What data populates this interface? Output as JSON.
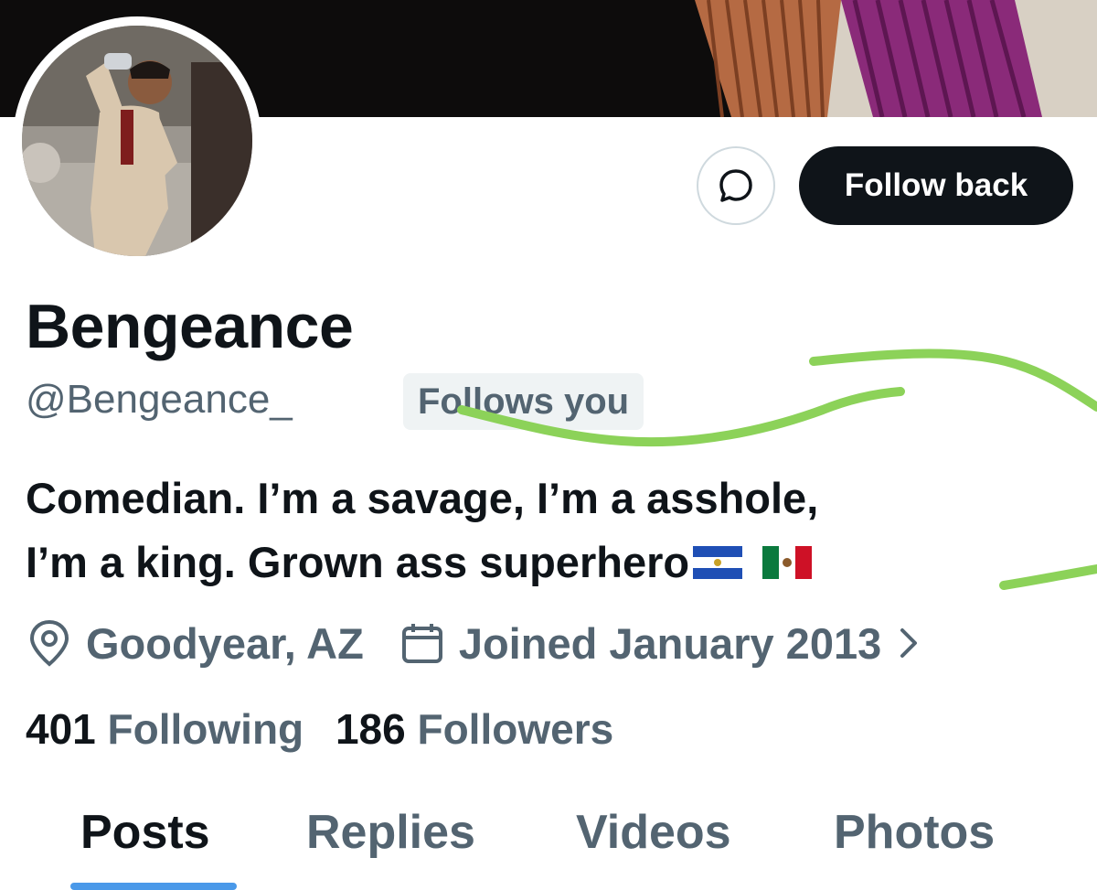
{
  "profile": {
    "display_name": "Bengeance",
    "handle": "@Bengeance_",
    "follows_you_badge": "Follows you",
    "bio_line1": "Comedian. I’m a savage, I’m a asshole,",
    "bio_line2": "I’m a king. Grown ass superhero",
    "location": "Goodyear, AZ",
    "joined": "Joined January 2013",
    "following_count": "401",
    "following_label": "Following",
    "followers_count": "186",
    "followers_label": "Followers"
  },
  "actions": {
    "message_icon": "chat-bubble-icon",
    "follow_back_label": "Follow back"
  },
  "icons": {
    "location": "location-pin-icon",
    "calendar": "calendar-icon",
    "chevron": "chevron-right-icon"
  },
  "tabs": [
    {
      "label": "Posts",
      "active": true
    },
    {
      "label": "Replies",
      "active": false
    },
    {
      "label": "Videos",
      "active": false
    },
    {
      "label": "Photos",
      "active": false
    }
  ],
  "colors": {
    "primary_text": "#0f1419",
    "secondary_text": "#536471",
    "tab_indicator": "#4a99e9",
    "annotation_scribble": "#8cd259"
  }
}
